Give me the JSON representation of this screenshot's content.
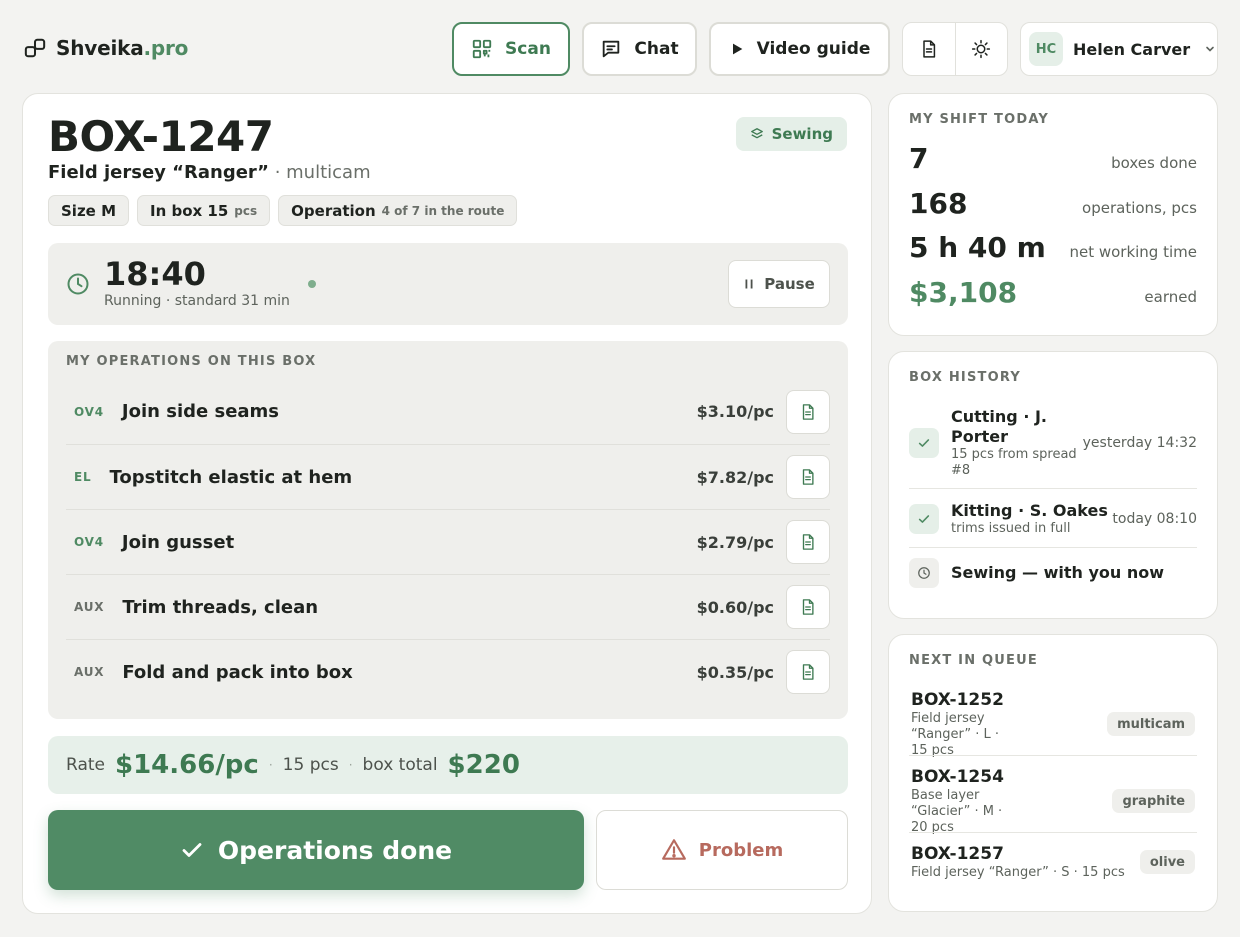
{
  "header": {
    "brand_main": "Shveika",
    "brand_accent": ".pro",
    "nav": {
      "scan_label": "Scan",
      "chat_label": "Chat",
      "video_label": "Video guide"
    },
    "user": {
      "initials": "HC",
      "name": "Helen Carver"
    }
  },
  "box": {
    "id": "BOX-1247",
    "stage": "Sewing",
    "product_name": "Field jersey “Ranger”",
    "product_sep": " · ",
    "product_color": "multicam",
    "chips": {
      "size": "Size M",
      "in_box": "In box 15",
      "in_box_unit": "pcs",
      "operation": "Operation",
      "operation_detail": "4 of 7 in the route"
    }
  },
  "timer": {
    "time": "18:40",
    "status": "Running · standard 31 min",
    "pause_label": "Pause"
  },
  "operations": {
    "title": "MY OPERATIONS ON THIS BOX",
    "items": [
      {
        "code": "OV4",
        "name": "Join side seams",
        "price": "$3.10/pc"
      },
      {
        "code": "EL",
        "name": "Topstitch elastic at hem",
        "price": "$7.82/pc"
      },
      {
        "code": "OV4",
        "name": "Join gusset",
        "price": "$2.79/pc"
      },
      {
        "code": "AUX",
        "name": "Trim threads, clean",
        "price": "$0.60/pc"
      },
      {
        "code": "AUX",
        "name": "Fold and pack into box",
        "price": "$0.35/pc"
      }
    ]
  },
  "rate": {
    "label": "Rate",
    "value": "$14.66/pc",
    "sep": "·",
    "qty": "15 pcs",
    "total_label": "box total",
    "total": "$220"
  },
  "actions": {
    "done_label": "Operations done",
    "problem_label": "Problem"
  },
  "shift": {
    "title": "MY SHIFT TODAY",
    "stats": [
      {
        "value": "7",
        "label": "boxes done"
      },
      {
        "value": "168",
        "label": "operations, pcs"
      },
      {
        "value": "5 h 40 m",
        "label": "net working time"
      },
      {
        "value": "$3,108",
        "label": "earned"
      }
    ]
  },
  "history": {
    "title": "BOX HISTORY",
    "items": [
      {
        "main": "Cutting · J. Porter",
        "sub": "15 pcs from spread #8",
        "time": "yesterday 14:32"
      },
      {
        "main": "Kitting · S. Oakes",
        "sub": "trims issued in full",
        "time": "today 08:10"
      },
      {
        "main": "Sewing — with you now"
      }
    ]
  },
  "queue": {
    "title": "NEXT IN QUEUE",
    "items": [
      {
        "id": "BOX-1252",
        "sub": "Field jersey “Ranger” · L · 15 pcs",
        "tag": "multicam"
      },
      {
        "id": "BOX-1254",
        "sub": "Base layer “Glacier” · M · 20 pcs",
        "tag": "graphite"
      },
      {
        "id": "BOX-1257",
        "sub": "Field jersey “Ranger” · S · 15 pcs",
        "tag": "olive"
      }
    ]
  },
  "colors": {
    "accent": "#4f8a63",
    "danger": "#b76a5e",
    "surface": "#efefec"
  }
}
